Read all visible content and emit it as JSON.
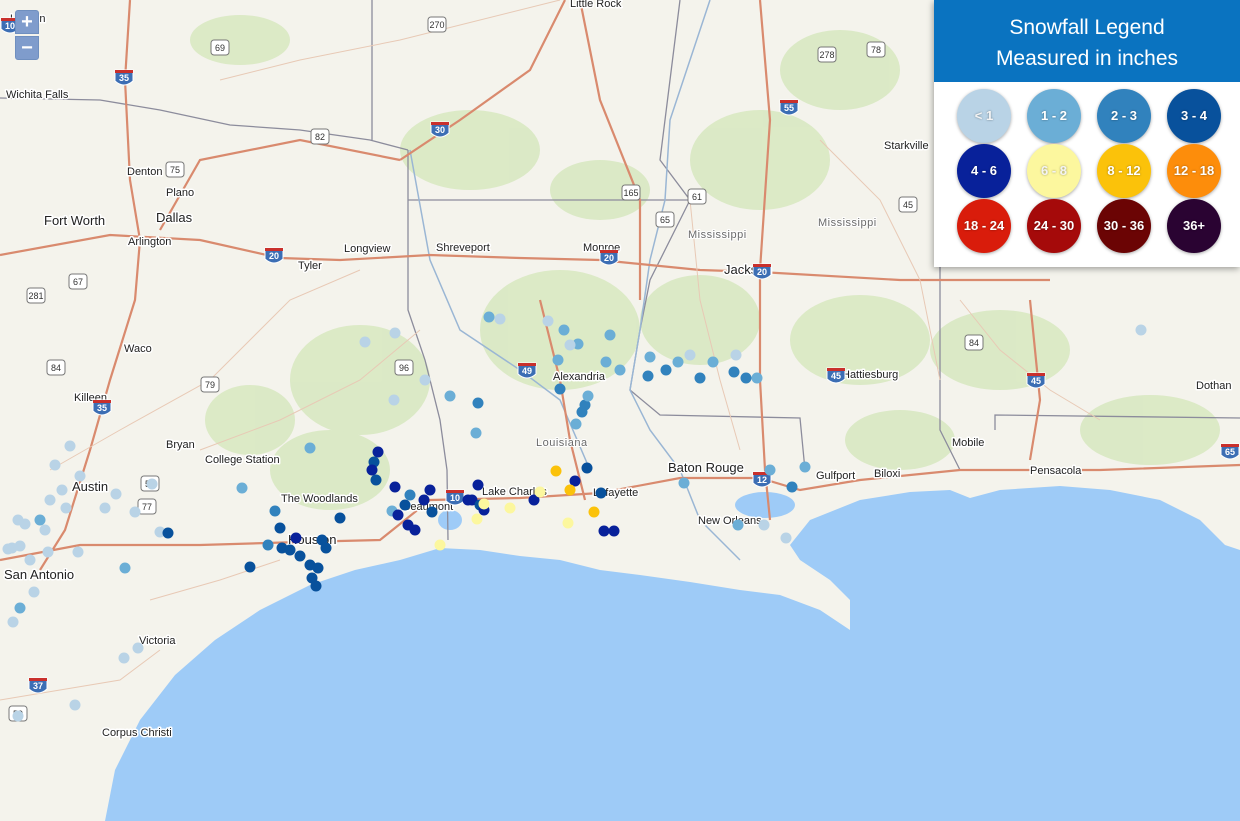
{
  "legend": {
    "title": "Snowfall Legend",
    "subtitle": "Measured in inches",
    "bins": [
      {
        "label": "< 1",
        "color": "#b9d3e6"
      },
      {
        "label": "1 - 2",
        "color": "#6baed6"
      },
      {
        "label": "2 - 3",
        "color": "#3182bd"
      },
      {
        "label": "3 - 4",
        "color": "#08519c"
      },
      {
        "label": "4 - 6",
        "color": "#08219a"
      },
      {
        "label": "6 - 8",
        "color": "#fcf79e"
      },
      {
        "label": "8 - 12",
        "color": "#fbc20a"
      },
      {
        "label": "12 - 18",
        "color": "#fd8d0b"
      },
      {
        "label": "18 - 24",
        "color": "#d91c0b"
      },
      {
        "label": "24 - 30",
        "color": "#a50a0a"
      },
      {
        "label": "30 - 36",
        "color": "#6b0404"
      },
      {
        "label": "36+",
        "color": "#2a0332"
      }
    ]
  },
  "controls": {
    "zoom_in": "+",
    "zoom_out": "−"
  },
  "map": {
    "ocean_color": "#9ecbf7",
    "land_color": "#f4f3ec",
    "states": [
      "Louisiana",
      "Mississippi",
      "Mississippi"
    ],
    "cities": [
      "Little Rock",
      "Wichita Falls",
      "Denton",
      "Plano",
      "Fort Worth",
      "Dallas",
      "Arlington",
      "Longview",
      "Shreveport",
      "Monroe",
      "Tyler",
      "Jackson",
      "Starkville",
      "Waco",
      "Killeen",
      "Alexandria",
      "Hattiesburg",
      "Bryan",
      "College Station",
      "Austin",
      "The Woodlands",
      "Beaumont",
      "Lake Charles",
      "Lafayette",
      "Baton Rouge",
      "Gulfport",
      "Biloxi",
      "Mobile",
      "Pensacola",
      "Dothan",
      "Houston",
      "New Orleans",
      "San Antonio",
      "Victoria",
      "Corpus Christi",
      "Lawton"
    ],
    "highway_shields": [
      "270",
      "69",
      "35",
      "82",
      "30",
      "75",
      "55",
      "278",
      "78",
      "165",
      "61",
      "65",
      "45",
      "20",
      "20",
      "20",
      "67",
      "281",
      "49",
      "96",
      "84",
      "79",
      "35",
      "77",
      "45",
      "45",
      "59",
      "37",
      "10",
      "12",
      "59",
      "65",
      "84",
      "10"
    ]
  }
}
